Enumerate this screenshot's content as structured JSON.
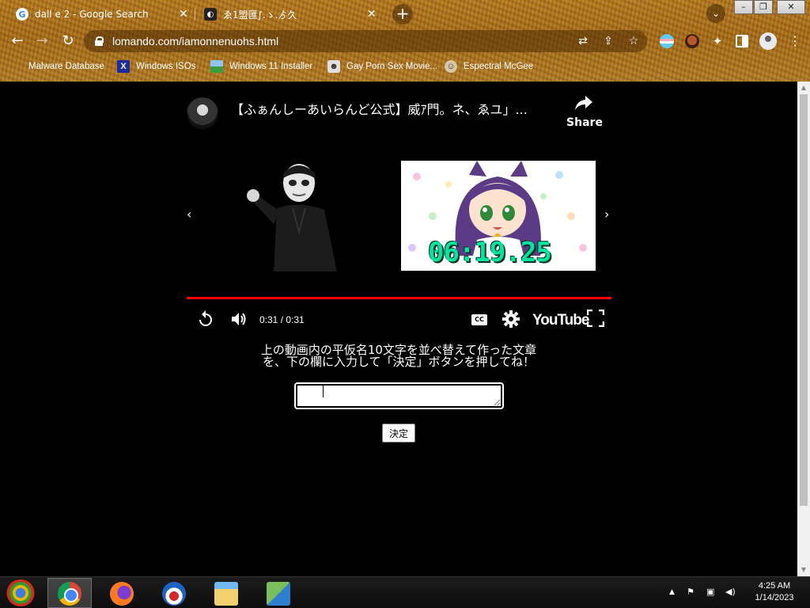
{
  "browser": {
    "tabs": [
      {
        "title": "dall e 2 - Google Search",
        "close": "✕"
      },
      {
        "title": "ゑ1盟匯∫.ゝ.ゟ久",
        "close": "✕"
      }
    ],
    "new_tab": "+",
    "tab_search": "⌄",
    "window_controls": {
      "minimize": "–",
      "maximize": "❐",
      "close": "✕"
    },
    "nav": {
      "back": "←",
      "forward": "→",
      "reload": "↻"
    },
    "url": "lomando.com/iamonnenuohs.html",
    "bookmarks": [
      {
        "label": "Malware Database",
        "icon": ""
      },
      {
        "label": "Windows ISOs",
        "icon": "X"
      },
      {
        "label": "Windows 11 Installer",
        "icon": ""
      },
      {
        "label": "Gay Porn Sex Movie...",
        "icon": "☻"
      },
      {
        "label": "Espectral McGee",
        "icon": "☺"
      }
    ]
  },
  "video": {
    "title": "【ふぁんしーあいらんど公式】威ｱ門。ネ、ゑユ」...",
    "share_label": "Share",
    "timer_overlay": "06:19.25",
    "progress": 1.0,
    "time_display": "0:31 / 0:31",
    "cc_label": "CC",
    "brand": "YouTube"
  },
  "form": {
    "instruction_line1": "上の動画内の平仮名10文字を並べ替えて作った文章",
    "instruction_line2": "を、下の欄に入力して「決定」ボタンを押してね！",
    "answer_value": "",
    "submit_label": "決定"
  },
  "taskbar": {
    "time": "4:25 AM",
    "date": "1/14/2023"
  },
  "colors": {
    "chrome_frame": "#b07420",
    "page_bg": "#000000",
    "progress_bar": "#ff0000",
    "timer_text": "#00e6a0"
  }
}
